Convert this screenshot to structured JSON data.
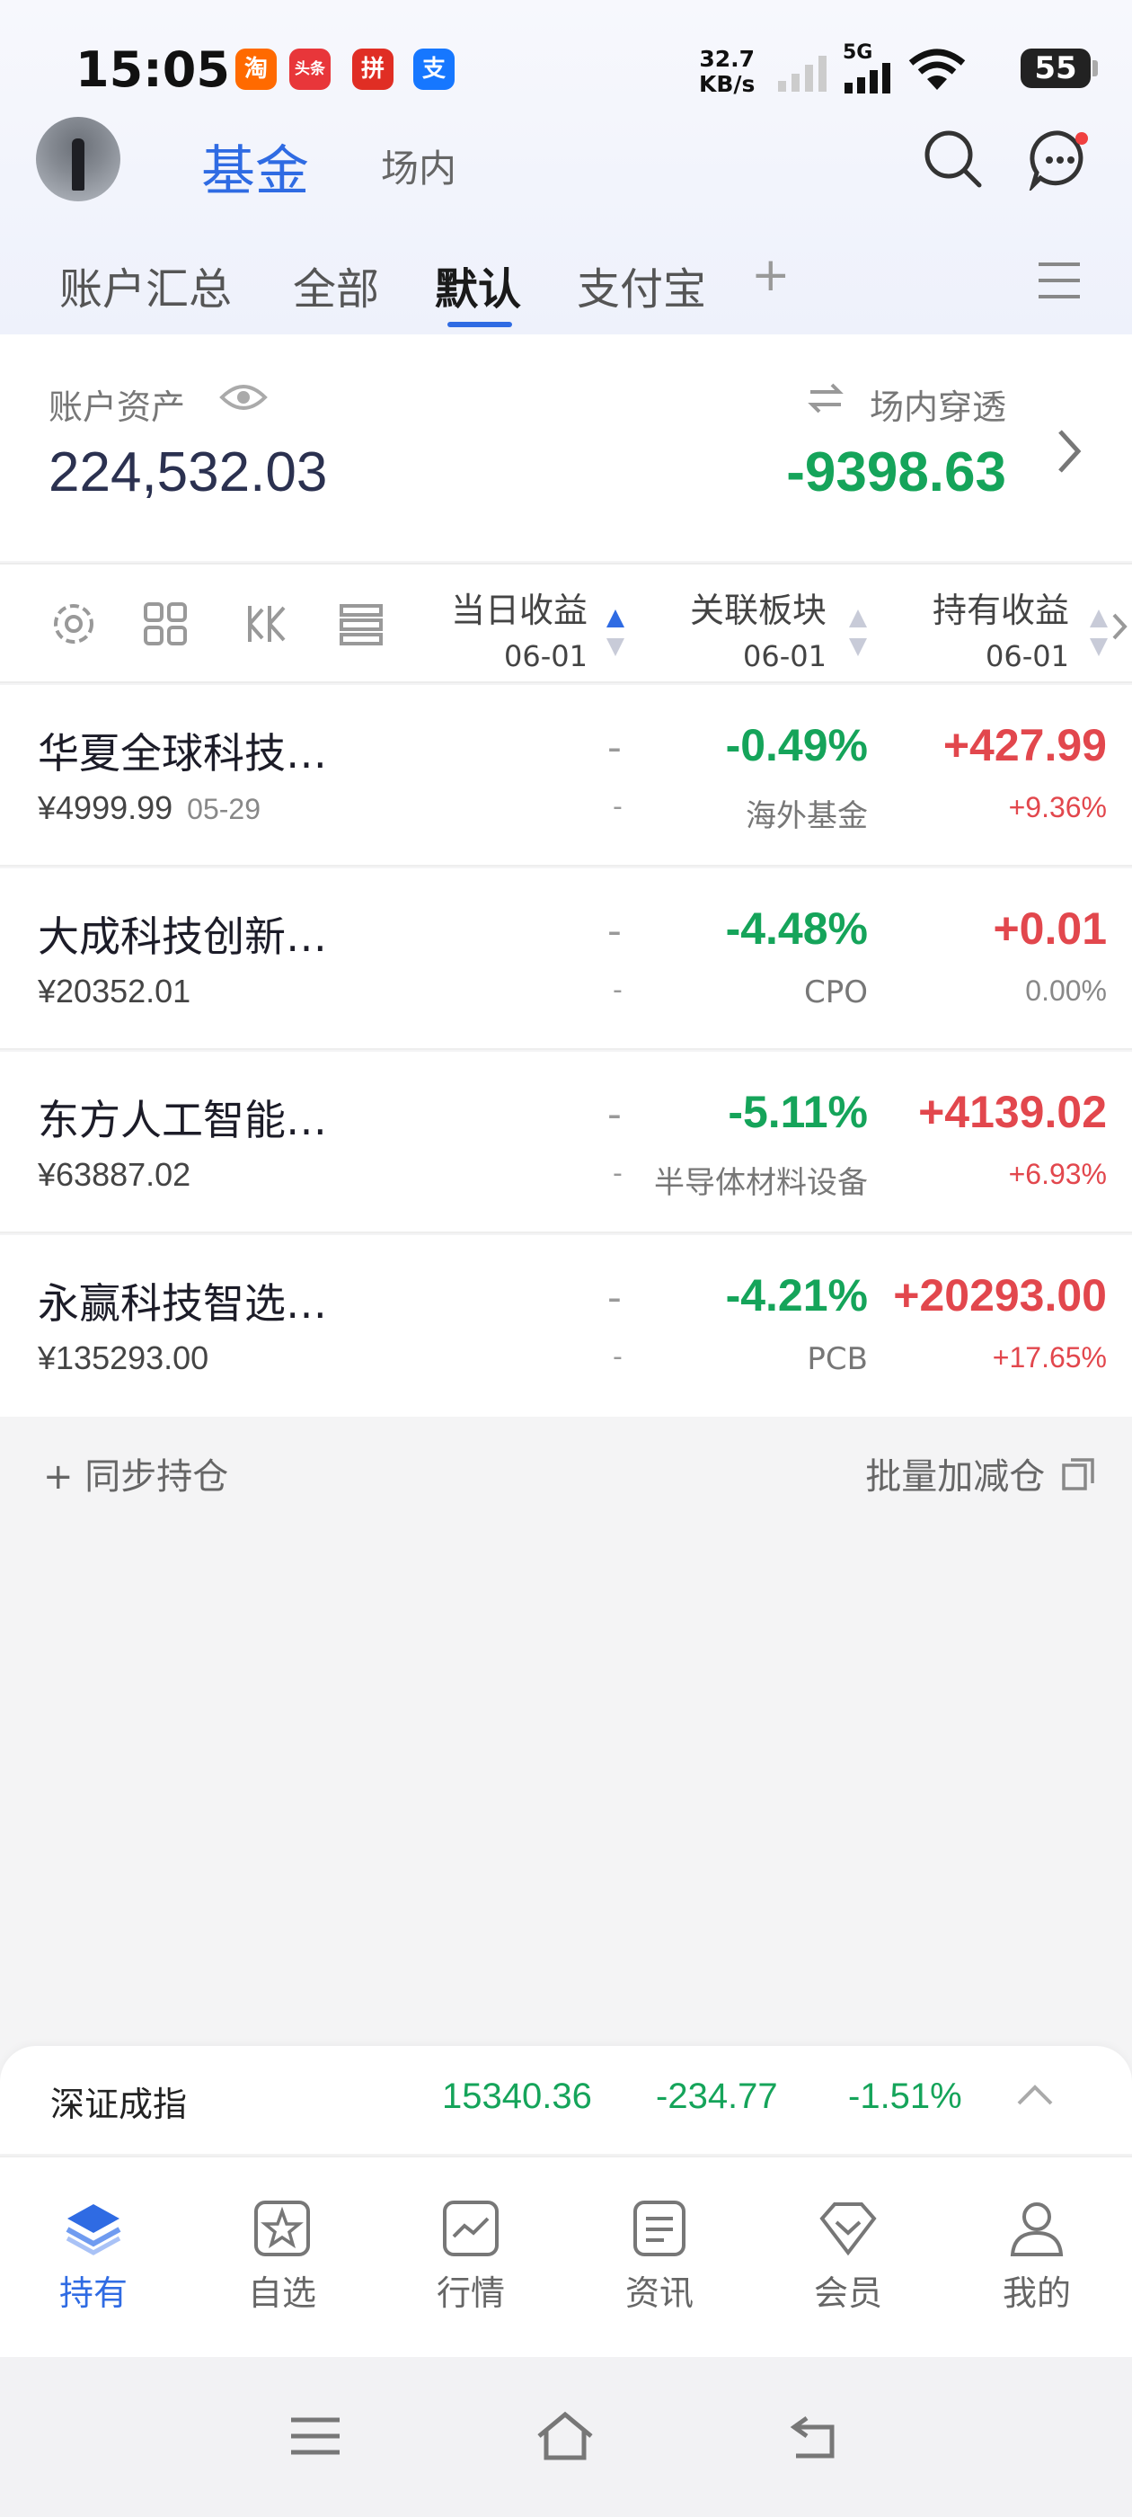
{
  "status_bar": {
    "time": "15:05",
    "apps": [
      {
        "icon": "taobao-icon",
        "glyph": "淘",
        "color": "#ff6a00"
      },
      {
        "icon": "toutiao-icon",
        "glyph": "头条",
        "color": "#e8363a"
      },
      {
        "icon": "pinduoduo-icon",
        "glyph": "拼",
        "color": "#e02e24"
      },
      {
        "icon": "alipay-icon",
        "glyph": "支",
        "color": "#1677ff"
      }
    ],
    "net_speed_value": "32.7",
    "net_speed_unit": "KB/s",
    "network": "5G",
    "battery": "55"
  },
  "header": {
    "title": "基金",
    "subtitle": "场内"
  },
  "tabs": [
    {
      "label": "账户汇总",
      "active": false
    },
    {
      "label": "全部",
      "active": false
    },
    {
      "label": "默认",
      "active": true
    },
    {
      "label": "支付宝",
      "active": false
    }
  ],
  "tabs_add": "+",
  "summary": {
    "assets_label": "账户资产",
    "assets_value": "224,532.03",
    "penetrate_label": "场内穿透",
    "penetrate_value": "-9398.63"
  },
  "table": {
    "columns": [
      {
        "label": "当日收益",
        "date": "06-01"
      },
      {
        "label": "关联板块",
        "date": "06-01"
      },
      {
        "label": "持有收益",
        "date": "06-01"
      }
    ],
    "rows": [
      {
        "name": "华夏全球科技…",
        "amount": "¥4999.99",
        "date": "05-29",
        "daily": "-",
        "daily_sub": "-",
        "sector_pct": "-0.49%",
        "sector": "海外基金",
        "hold": "+427.99",
        "hold_pct": "+9.36%"
      },
      {
        "name": "大成科技创新…",
        "amount": "¥20352.01",
        "date": "",
        "daily": "-",
        "daily_sub": "-",
        "sector_pct": "-4.48%",
        "sector": "CPO",
        "hold": "+0.01",
        "hold_pct": "0.00%"
      },
      {
        "name": "东方人工智能…",
        "amount": "¥63887.02",
        "date": "",
        "daily": "-",
        "daily_sub": "-",
        "sector_pct": "-5.11%",
        "sector": "半导体材料设备",
        "hold": "+4139.02",
        "hold_pct": "+6.93%"
      },
      {
        "name": "永赢科技智选…",
        "amount": "¥135293.00",
        "date": "",
        "daily": "-",
        "daily_sub": "-",
        "sector_pct": "-4.21%",
        "sector": "PCB",
        "hold": "+20293.00",
        "hold_pct": "+17.65%"
      }
    ]
  },
  "actions": {
    "sync": "+ 同步持仓",
    "batch": "批量加减仓"
  },
  "ticker": {
    "name": "深证成指",
    "value": "15340.36",
    "change": "-234.77",
    "change_pct": "-1.51%"
  },
  "bottom_nav": [
    {
      "label": "持有",
      "icon": "layers-icon",
      "active": true
    },
    {
      "label": "自选",
      "icon": "star-icon",
      "active": false
    },
    {
      "label": "行情",
      "icon": "chart-icon",
      "active": false
    },
    {
      "label": "资讯",
      "icon": "news-icon",
      "active": false
    },
    {
      "label": "会员",
      "icon": "diamond-icon",
      "active": false
    },
    {
      "label": "我的",
      "icon": "user-icon",
      "active": false
    }
  ],
  "colors": {
    "accent": "#2f6be3",
    "gain": "#e2474d",
    "loss": "#15a45a"
  }
}
